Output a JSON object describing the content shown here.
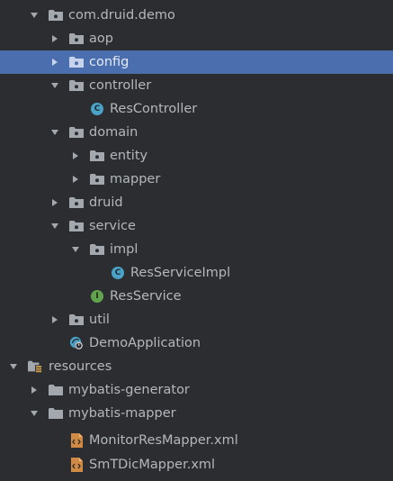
{
  "tree": {
    "items": [
      {
        "label": "com.druid.demo",
        "icon": "package-folder-icon",
        "state": "expanded"
      },
      {
        "label": "aop",
        "icon": "package-folder-icon",
        "state": "collapsed"
      },
      {
        "label": "config",
        "icon": "package-folder-icon",
        "state": "collapsed",
        "selected": true
      },
      {
        "label": "controller",
        "icon": "package-folder-icon",
        "state": "expanded"
      },
      {
        "label": "ResController",
        "icon": "java-class-icon",
        "badge": "C"
      },
      {
        "label": "domain",
        "icon": "package-folder-icon",
        "state": "expanded"
      },
      {
        "label": "entity",
        "icon": "package-folder-icon",
        "state": "collapsed"
      },
      {
        "label": "mapper",
        "icon": "package-folder-icon",
        "state": "collapsed"
      },
      {
        "label": "druid",
        "icon": "package-folder-icon",
        "state": "collapsed"
      },
      {
        "label": "service",
        "icon": "package-folder-icon",
        "state": "expanded"
      },
      {
        "label": "impl",
        "icon": "package-folder-icon",
        "state": "expanded"
      },
      {
        "label": "ResServiceImpl",
        "icon": "java-class-icon",
        "badge": "C"
      },
      {
        "label": "ResService",
        "icon": "java-interface-icon",
        "badge": "I"
      },
      {
        "label": "util",
        "icon": "package-folder-icon",
        "state": "collapsed"
      },
      {
        "label": "DemoApplication",
        "icon": "spring-boot-application-icon"
      },
      {
        "label": "resources",
        "icon": "resources-folder-icon",
        "state": "expanded"
      },
      {
        "label": "mybatis-generator",
        "icon": "folder-icon",
        "state": "collapsed"
      },
      {
        "label": "mybatis-mapper",
        "icon": "folder-icon",
        "state": "expanded"
      },
      {
        "label": "MonitorResMapper.xml",
        "icon": "xml-file-icon"
      },
      {
        "label": "SmTDicMapper.xml",
        "icon": "xml-file-icon"
      }
    ]
  },
  "colors": {
    "background": "#2b2d30",
    "selection": "#4b6eaf",
    "text": "#b4b8bd",
    "folder": "#a3a8ae",
    "class_badge": "#4aa3c7",
    "interface_badge": "#62a34d",
    "xml": "#d08a44"
  }
}
